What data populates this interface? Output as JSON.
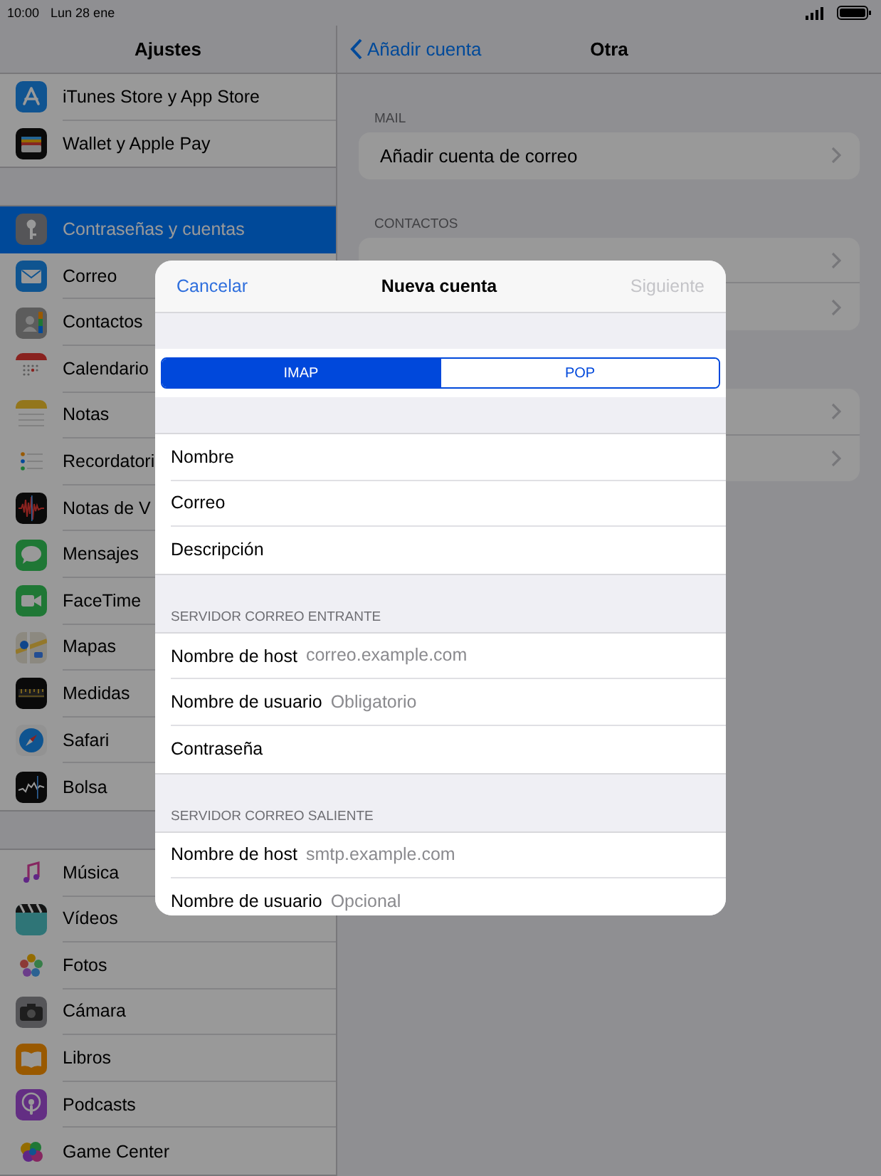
{
  "status_bar": {
    "time": "10:00",
    "date": "Lun 28 ene"
  },
  "sidebar": {
    "title": "Ajustes",
    "groups": [
      {
        "items": [
          {
            "label": "iTunes Store y App Store",
            "selected": false
          },
          {
            "label": "Wallet y Apple Pay",
            "selected": false
          }
        ]
      },
      {
        "items": [
          {
            "label": "Contraseñas y cuentas",
            "selected": true
          },
          {
            "label": "Correo",
            "selected": false
          },
          {
            "label": "Contactos",
            "selected": false
          },
          {
            "label": "Calendario",
            "selected": false
          },
          {
            "label": "Notas",
            "selected": false
          },
          {
            "label": "Recordatori",
            "selected": false
          },
          {
            "label": "Notas de V",
            "selected": false
          },
          {
            "label": "Mensajes",
            "selected": false
          },
          {
            "label": "FaceTime",
            "selected": false
          },
          {
            "label": "Mapas",
            "selected": false
          },
          {
            "label": "Medidas",
            "selected": false
          },
          {
            "label": "Safari",
            "selected": false
          },
          {
            "label": "Bolsa",
            "selected": false
          }
        ]
      },
      {
        "items": [
          {
            "label": "Música",
            "selected": false
          },
          {
            "label": "Vídeos",
            "selected": false
          },
          {
            "label": "Fotos",
            "selected": false
          },
          {
            "label": "Cámara",
            "selected": false
          },
          {
            "label": "Libros",
            "selected": false
          },
          {
            "label": "Podcasts",
            "selected": false
          },
          {
            "label": "Game Center",
            "selected": false
          }
        ]
      }
    ]
  },
  "detail": {
    "back": "Añadir cuenta",
    "title": "Otra",
    "groups": [
      {
        "header": "MAIL",
        "rows": [
          {
            "kind": "link",
            "label": "Añadir cuenta de correo"
          }
        ]
      },
      {
        "header": "CONTACTOS",
        "rows": [
          {
            "kind": "link"
          },
          {
            "kind": "link"
          }
        ]
      },
      {
        "rows": [
          {
            "kind": "link"
          },
          {
            "kind": "link"
          }
        ]
      }
    ]
  },
  "sheet": {
    "cancel": "Cancelar",
    "title": "Nueva cuenta",
    "next": {
      "label": "Siguiente",
      "disabled": true
    },
    "segments": [
      {
        "label": "IMAP",
        "selected": true
      },
      {
        "label": "POP",
        "selected": false
      }
    ],
    "sections": [
      {
        "fields": [
          {
            "label": "Nombre"
          },
          {
            "label": "Correo"
          },
          {
            "label": "Descripción"
          }
        ]
      },
      {
        "header": "SERVIDOR CORREO ENTRANTE",
        "fields": [
          {
            "label": "Nombre de host",
            "placeholder": "correo.example.com"
          },
          {
            "label": "Nombre de usuario",
            "placeholder": "Obligatorio"
          },
          {
            "label": "Contraseña"
          }
        ]
      },
      {
        "header": "SERVIDOR CORREO SALIENTE",
        "fields": [
          {
            "label": "Nombre de host",
            "placeholder": "smtp.example.com"
          },
          {
            "label": "Nombre de usuario",
            "placeholder": "Opcional"
          }
        ]
      }
    ]
  }
}
